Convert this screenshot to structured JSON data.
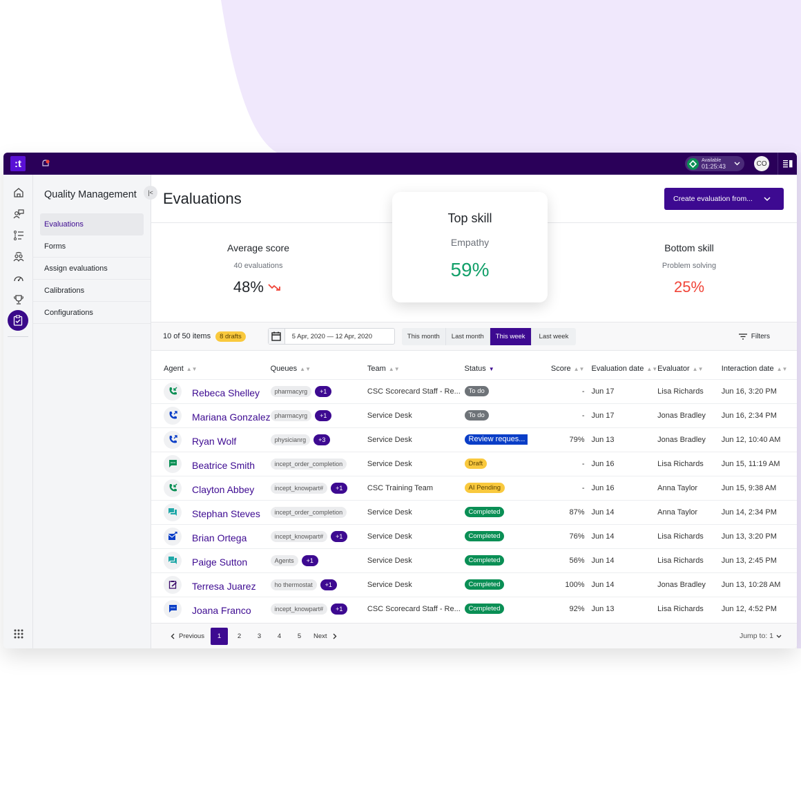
{
  "topbar": {
    "logo_text": ":t",
    "presence_label": "Available",
    "presence_time": "01:25:43",
    "avatar_initials": "CO"
  },
  "subnav": {
    "title": "Quality Management",
    "items": [
      {
        "label": "Evaluations",
        "active": true
      },
      {
        "label": "Forms"
      },
      {
        "label": "Assign evaluations"
      },
      {
        "label": "Calibrations"
      },
      {
        "label": "Configurations"
      }
    ]
  },
  "main": {
    "title": "Evaluations",
    "create_button": "Create evaluation from...",
    "stats": {
      "average": {
        "title": "Average score",
        "sub": "40 evaluations",
        "value": "48%",
        "trend": "down"
      },
      "top": {
        "title": "Top skill",
        "sub": "Empathy",
        "value": "59%"
      },
      "bottom": {
        "title": "Bottom skill",
        "sub": "Problem solving",
        "value": "25%"
      }
    },
    "toolbar": {
      "count": "10 of 50 items",
      "drafts": "8 drafts",
      "date_range": "5 Apr, 2020 — 12 Apr, 2020",
      "ranges": [
        "This month",
        "Last month",
        "This week",
        "Last week"
      ],
      "active_range": "This week",
      "filters": "Filters"
    },
    "columns": [
      "Agent",
      "Queues",
      "Team",
      "Status",
      "Score",
      "Evaluation date",
      "Evaluator",
      "Interaction date"
    ],
    "rows": [
      {
        "channel": "phone-inbound",
        "agent": "Rebeca Shelley",
        "queue": "pharmacyrg",
        "extra": "+1",
        "team": "CSC Scorecard Staff - Re...",
        "status": "To do",
        "status_type": "todo",
        "score": "-",
        "eval_date": "Jun 17",
        "evaluator": "Lisa Richards",
        "interaction": "Jun 16, 3:20 PM"
      },
      {
        "channel": "phone-outbound",
        "agent": "Mariana Gonzalez",
        "queue": "pharmacyrg",
        "extra": "+1",
        "team": "Service Desk",
        "status": "To do",
        "status_type": "todo",
        "score": "-",
        "eval_date": "Jun 17",
        "evaluator": "Jonas Bradley",
        "interaction": "Jun 16, 2:34 PM"
      },
      {
        "channel": "phone-outbound",
        "agent": "Ryan Wolf",
        "queue": "physicianrg",
        "extra": "+3",
        "team": "Service Desk",
        "status": "Review reques...",
        "status_type": "review",
        "score": "79%",
        "eval_date": "Jun 13",
        "evaluator": "Jonas Bradley",
        "interaction": "Jun 12, 10:40 AM"
      },
      {
        "channel": "sms",
        "agent": "Beatrice Smith",
        "queue": "incept_order_completion",
        "extra": "",
        "team": "Service Desk",
        "status": "Draft",
        "status_type": "draft",
        "score": "-",
        "eval_date": "Jun 16",
        "evaluator": "Lisa Richards",
        "interaction": "Jun 15, 11:19 AM"
      },
      {
        "channel": "phone-inbound",
        "agent": "Clayton Abbey",
        "queue": "incept_knowpart#",
        "extra": "+1",
        "team": "CSC Training Team",
        "status": "AI Pending",
        "status_type": "ai",
        "score": "-",
        "eval_date": "Jun 16",
        "evaluator": "Anna Taylor",
        "interaction": "Jun 15, 9:38 AM"
      },
      {
        "channel": "chat",
        "agent": "Stephan Steves",
        "queue": "incept_order_completion",
        "extra": "",
        "team": "Service Desk",
        "status": "Completed",
        "status_type": "done",
        "score": "87%",
        "eval_date": "Jun 14",
        "evaluator": "Anna Taylor",
        "interaction": "Jun 14, 2:34 PM"
      },
      {
        "channel": "email",
        "agent": "Brian Ortega",
        "queue": "incept_knowpart#",
        "extra": "+1",
        "team": "Service Desk",
        "status": "Completed",
        "status_type": "done",
        "score": "76%",
        "eval_date": "Jun 14",
        "evaluator": "Lisa Richards",
        "interaction": "Jun 13, 3:20 PM"
      },
      {
        "channel": "chat",
        "agent": "Paige Sutton",
        "queue": "Agents",
        "extra": "+1",
        "team": "Service Desk",
        "status": "Completed",
        "status_type": "done",
        "score": "56%",
        "eval_date": "Jun 14",
        "evaluator": "Lisa Richards",
        "interaction": "Jun 13, 2:45 PM"
      },
      {
        "channel": "task",
        "agent": "Terresa Juarez",
        "queue": "ho thermostat",
        "extra": "+1",
        "team": "Service Desk",
        "status": "Completed",
        "status_type": "done",
        "score": "100%",
        "eval_date": "Jun 14",
        "evaluator": "Jonas Bradley",
        "interaction": "Jun 13, 10:28 AM"
      },
      {
        "channel": "messaging",
        "agent": "Joana Franco",
        "queue": "incept_knowpart#",
        "extra": "+1",
        "team": "CSC Scorecard Staff - Re...",
        "status": "Completed",
        "status_type": "done",
        "score": "92%",
        "eval_date": "Jun 13",
        "evaluator": "Lisa Richards",
        "interaction": "Jun 12, 4:52 PM"
      }
    ],
    "pagination": {
      "previous": "Previous",
      "next": "Next",
      "pages": [
        "1",
        "2",
        "3",
        "4",
        "5"
      ],
      "current": "1",
      "jump_label": "Jump to: 1"
    }
  },
  "colors": {
    "brand": "#3d0a91",
    "topbar": "#2a0059",
    "positive": "#13a06a",
    "negative": "#f04438",
    "completed": "#0a8f55",
    "review": "#0a3ec7",
    "draft": "#f9c93e"
  }
}
